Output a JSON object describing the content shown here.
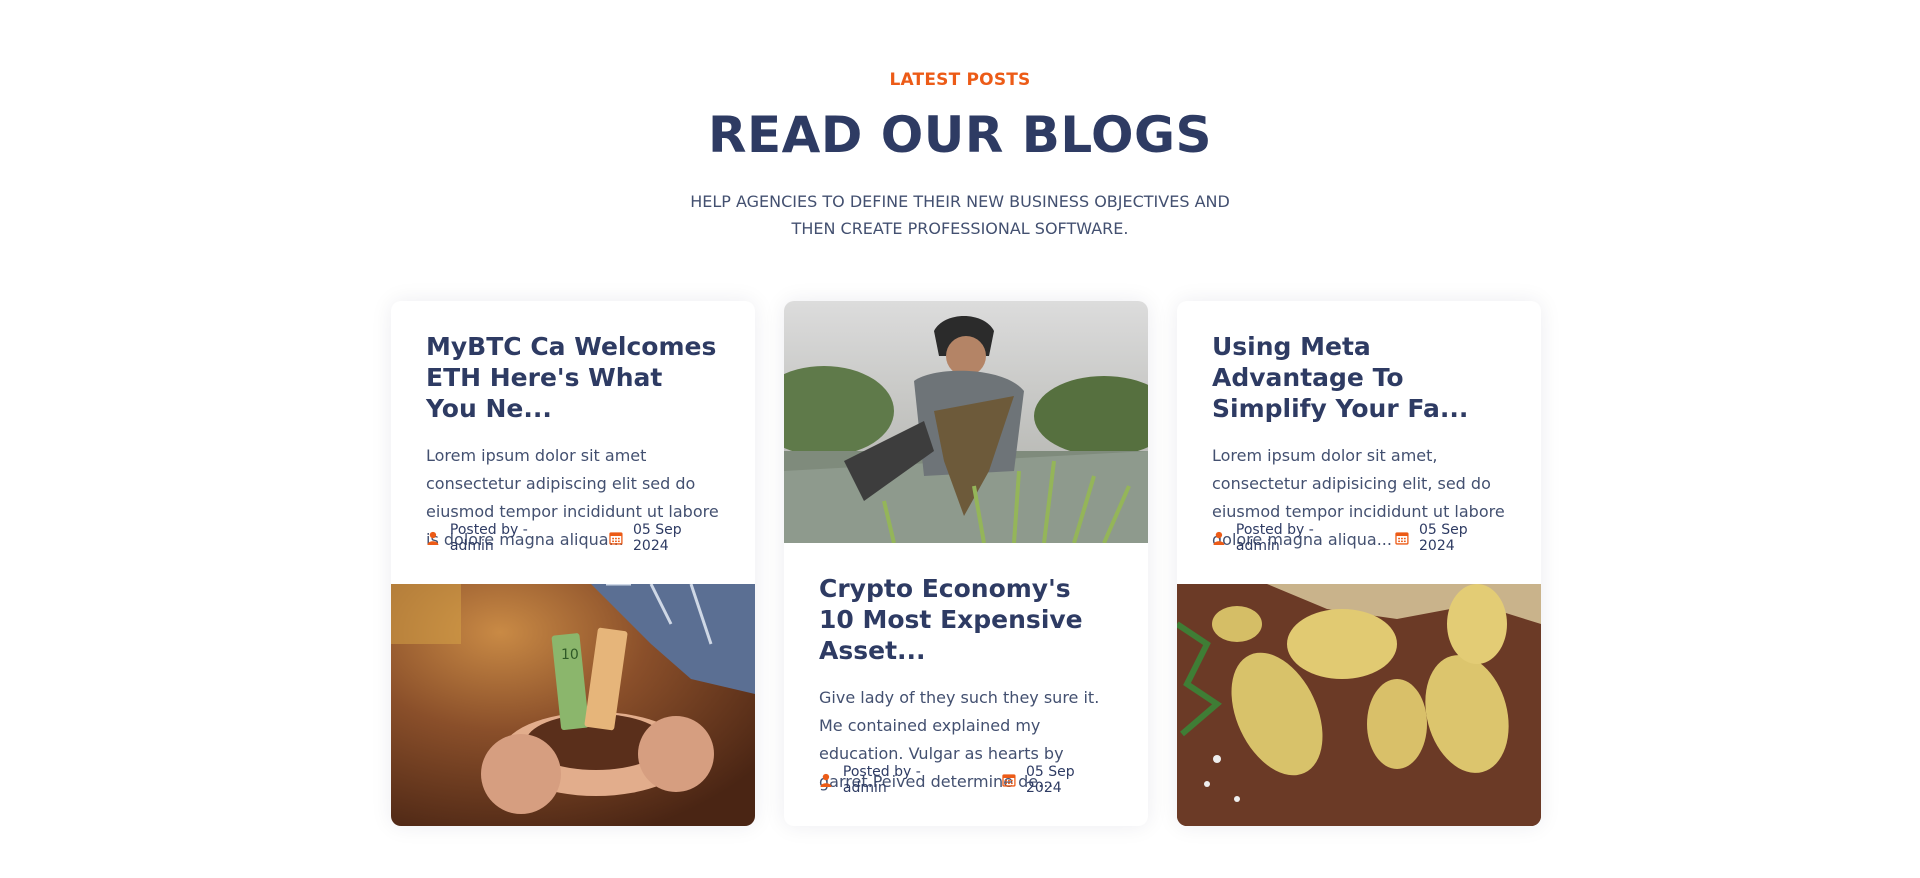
{
  "header": {
    "eyebrow": "LATEST POSTS",
    "title": "READ OUR BLOGS",
    "subtitle": "HELP AGENCIES TO DEFINE THEIR NEW BUSINESS OBJECTIVES AND THEN CREATE PROFESSIONAL SOFTWARE."
  },
  "posts": [
    {
      "title": "MyBTC Ca Welcomes ETH Here's What You Ne...",
      "excerpt": "Lorem ipsum dolor sit amet consectetur adipiscing elit sed do eiusmod tempor incididunt ut labore is dolore magna aliqua...",
      "author": "Posted by - admin",
      "date": "05 Sep 2024"
    },
    {
      "title": "Crypto Economy's 10 Most Expensive Asset...",
      "excerpt": "Give lady of they such they sure it. Me contained explained my education. Vulgar as hearts by garret.Peived determine de...",
      "author": "Posted by - admin",
      "date": "05 Sep 2024"
    },
    {
      "title": "Using Meta Advantage To Simplify Your Fa...",
      "excerpt": "Lorem ipsum dolor sit amet, consectetur adipisicing elit, sed do eiusmod tempor incididunt ut labore dolore magna aliqua...",
      "author": "Posted by - admin",
      "date": "05 Sep 2024"
    }
  ],
  "icons": {
    "author": "user-icon",
    "date": "calendar-icon"
  },
  "colors": {
    "accent": "#ec5b17",
    "heading": "#2e3b63",
    "text": "#435070"
  }
}
